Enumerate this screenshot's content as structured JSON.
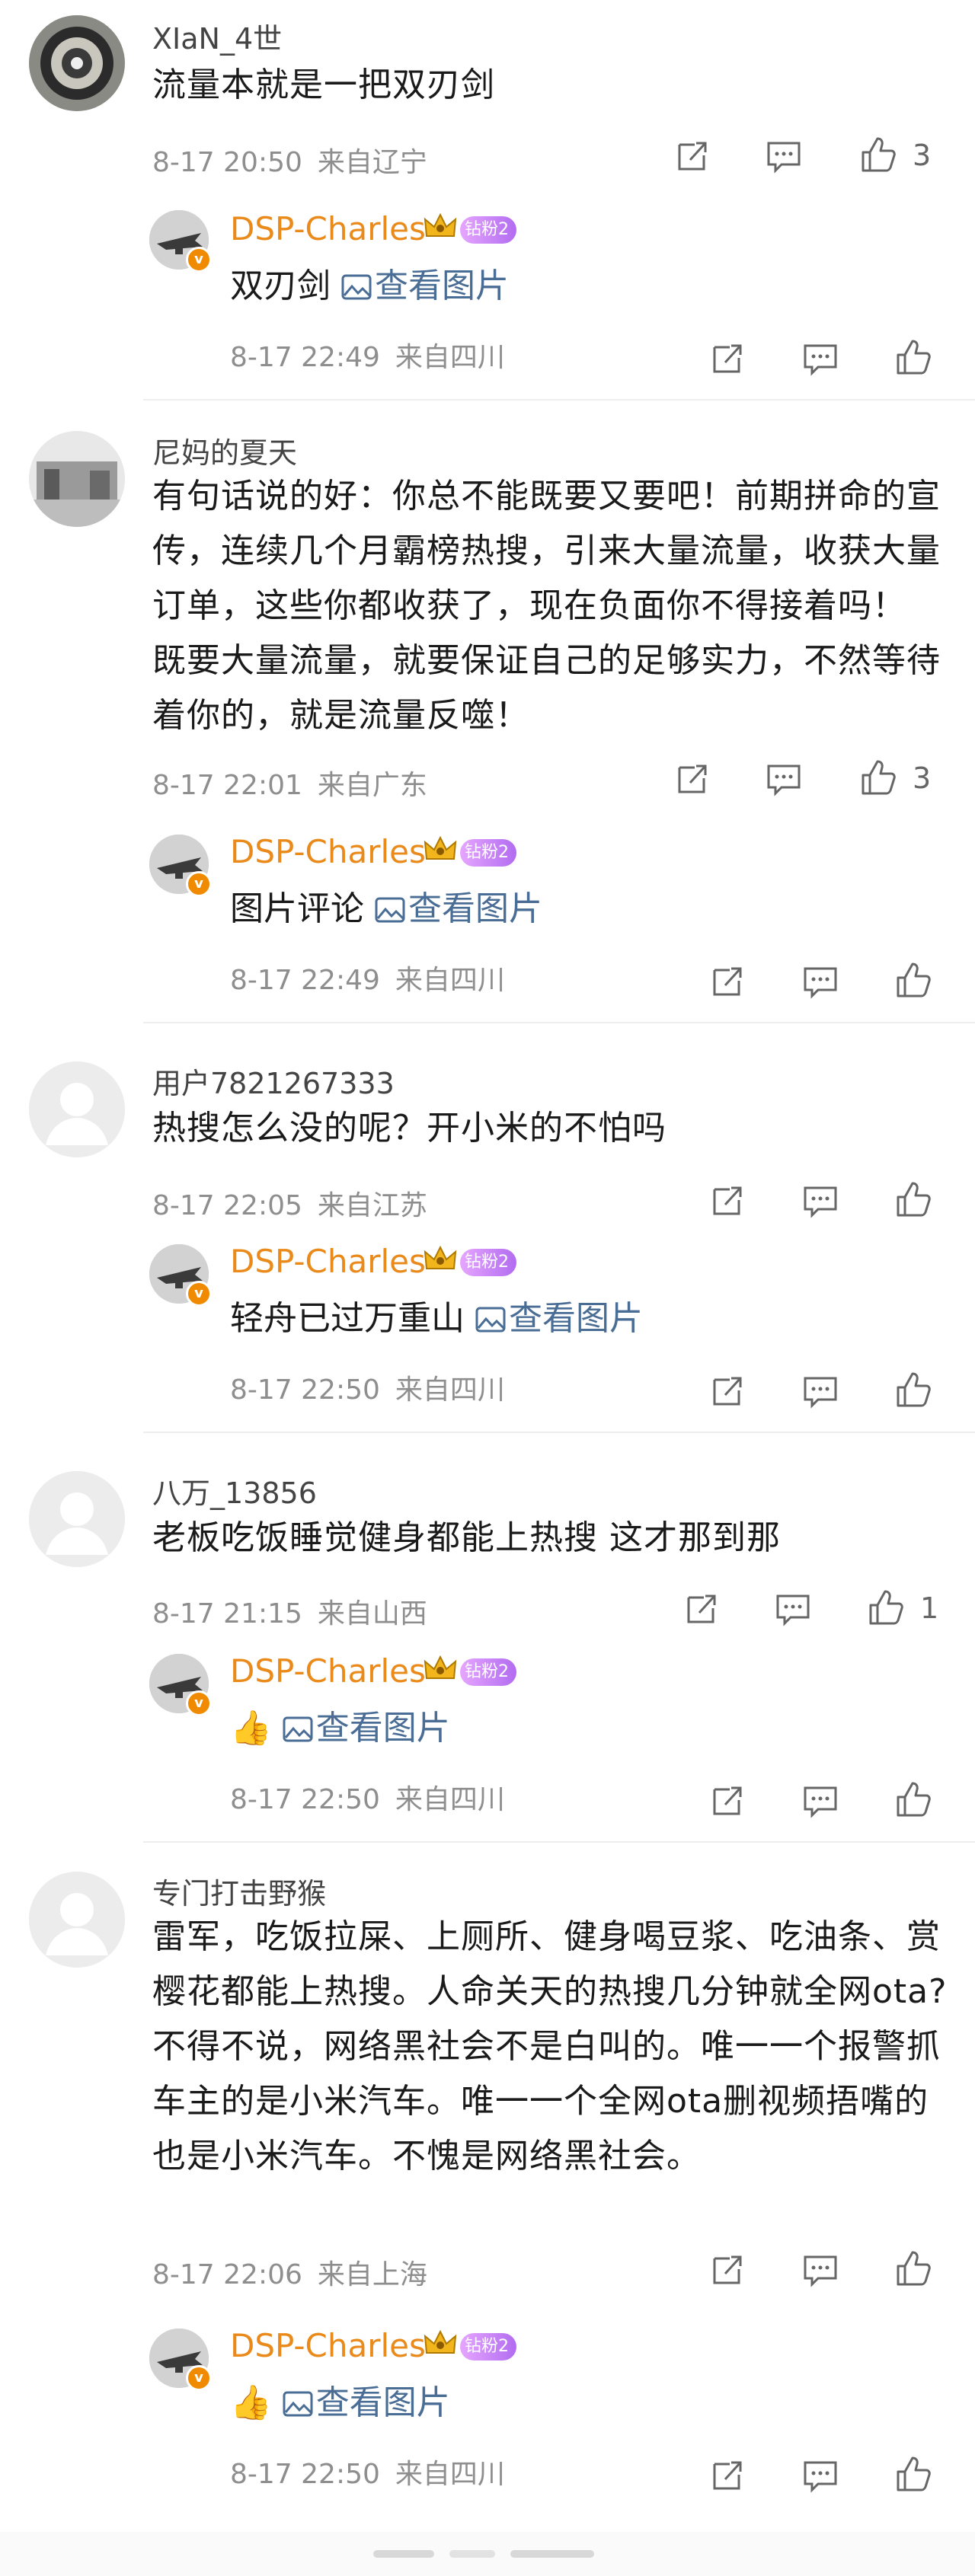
{
  "colors": {
    "username": "#444444",
    "reply_name": "#e98a1a",
    "link": "#4a6d96",
    "meta": "#8e8e8e"
  },
  "image_link_label": "查看图片",
  "comments": [
    {
      "user": "XIaN_4世",
      "text": "流量本就是一把双刃剑",
      "time": "8-17 20:50",
      "location": "来自辽宁",
      "likes": "3",
      "reply": {
        "user": "DSP-Charles",
        "badge": "钻粉2",
        "text": "双刃剑",
        "time": "8-17 22:49",
        "location": "来自四川"
      }
    },
    {
      "user": "尼妈的夏天",
      "text": "有句话说的好：你总不能既要又要吧！前期拼命的宣传，连续几个月霸榜热搜，引来大量流量，收获大量订单，这些你都收获了，现在负面你不得接着吗！ 既要大量流量，就要保证自己的足够实力，不然等待着你的，就是流量反噬！",
      "time": "8-17 22:01",
      "location": "来自广东",
      "likes": "3",
      "reply": {
        "user": "DSP-Charles",
        "badge": "钻粉2",
        "text": "图片评论",
        "time": "8-17 22:49",
        "location": "来自四川"
      }
    },
    {
      "user": "用户7821267333",
      "text": "热搜怎么没的呢？开小米的不怕吗",
      "time": "8-17 22:05",
      "location": "来自江苏",
      "likes": "",
      "reply": {
        "user": "DSP-Charles",
        "badge": "钻粉2",
        "text": "轻舟已过万重山",
        "time": "8-17 22:50",
        "location": "来自四川"
      }
    },
    {
      "user": "八万_13856",
      "text": "老板吃饭睡觉健身都能上热搜  这才那到那",
      "time": "8-17 21:15",
      "location": "来自山西",
      "likes": "1",
      "reply": {
        "user": "DSP-Charles",
        "badge": "钻粉2",
        "text": "👍",
        "time": "8-17 22:50",
        "location": "来自四川"
      }
    },
    {
      "user": "专门打击野猴",
      "text": "雷军，吃饭拉屎、上厕所、健身喝豆浆、吃油条、赏樱花都能上热搜。人命关天的热搜几分钟就全网ota?不得不说，网络黑社会不是白叫的。唯一一个报警抓车主的是小米汽车。唯一一个全网ota删视频捂嘴的也是小米汽车。不愧是网络黑社会。",
      "time": "8-17 22:06",
      "location": "来自上海",
      "likes": "",
      "reply": {
        "user": "DSP-Charles",
        "badge": "钻粉2",
        "text": "👍",
        "time": "8-17 22:50",
        "location": "来自四川"
      }
    }
  ]
}
